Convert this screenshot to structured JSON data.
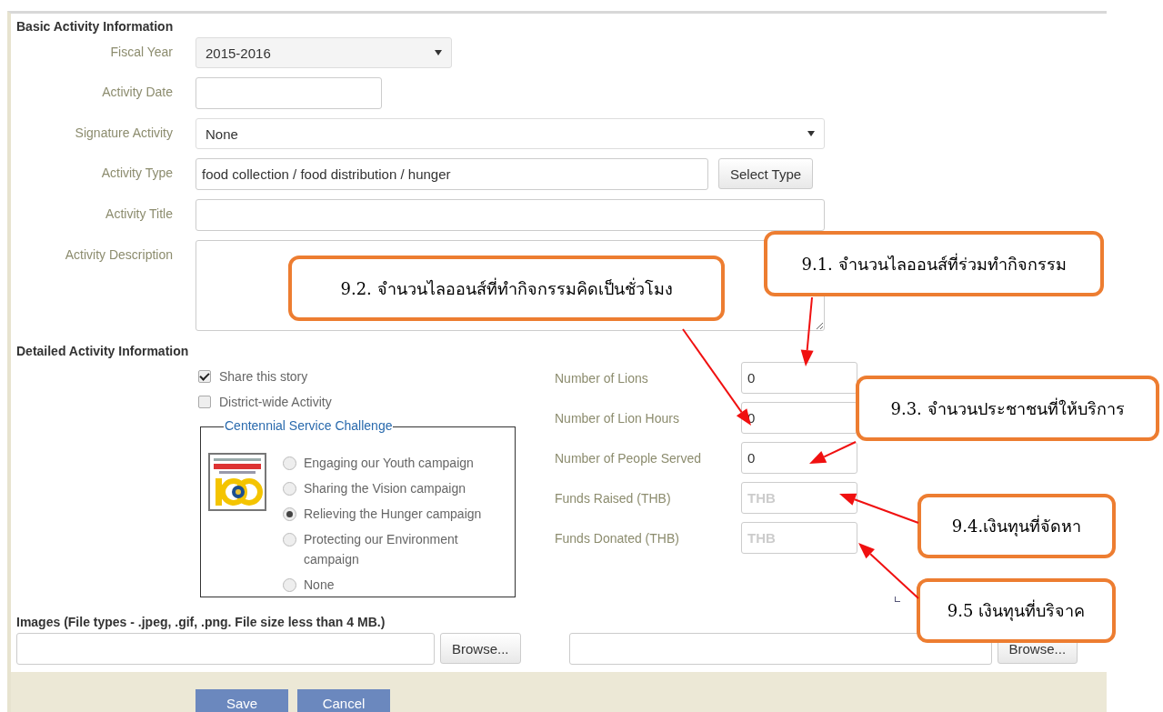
{
  "basic": {
    "title": "Basic Activity Information",
    "fields": [
      {
        "kind": "select",
        "label": "Fiscal Year",
        "value": "2015-2016"
      },
      {
        "kind": "text",
        "label": "Activity Date"
      },
      {
        "kind": "select",
        "label": "Signature Activity",
        "value": "None"
      },
      {
        "kind": "picker",
        "label": "Activity Type",
        "value": "food collection / food distribution / hunger",
        "button": "Select Type"
      },
      {
        "kind": "text",
        "label": "Activity Title"
      },
      {
        "kind": "textarea",
        "label": "Activity Description"
      }
    ]
  },
  "detailed": {
    "title": "Detailed Activity Information",
    "checkboxes": [
      {
        "label": "Share this story",
        "checked": true
      },
      {
        "label": "District-wide Activity",
        "checked": false
      }
    ],
    "challenge": {
      "legend": "Centennial Service Challenge",
      "options": [
        {
          "label": "Engaging our Youth campaign",
          "selected": false
        },
        {
          "label": "Sharing the Vision campaign",
          "selected": false
        },
        {
          "label": "Relieving the Hunger campaign",
          "selected": true
        },
        {
          "label": "Protecting our Environment campaign",
          "selected": false
        },
        {
          "label": "None",
          "selected": false
        }
      ]
    },
    "numbers": [
      {
        "label": "Number of Lions",
        "value": "0"
      },
      {
        "label": "Number of Lion Hours",
        "value": "0"
      },
      {
        "label": "Number of People Served",
        "value": "0"
      },
      {
        "label": "Funds Raised (THB)",
        "placeholder": "THB"
      },
      {
        "label": "Funds Donated (THB)",
        "placeholder": "THB"
      }
    ]
  },
  "images": {
    "label": "Images (File types - .jpeg, .gif, .png. File size less than 4 MB.)",
    "files": [
      {
        "button": "Browse..."
      },
      {
        "button": "Browse..."
      }
    ]
  },
  "buttons": [
    "Save",
    "Cancel"
  ],
  "callouts": [
    {
      "text": "9.1. จำนวนไลออนส์ที่ร่วมทำกิจกรรม"
    },
    {
      "text": "9.2. จำนวนไลออนส์ที่ทำกิจกรรมคิดเป็นชั่วโมง"
    },
    {
      "text": "9.3. จำนวนประชาชนที่ให้บริการ"
    },
    {
      "text": "9.4.เงินทุนที่จัดหา"
    },
    {
      "text": "9.5 เงินทุนที่บริจาค"
    }
  ]
}
